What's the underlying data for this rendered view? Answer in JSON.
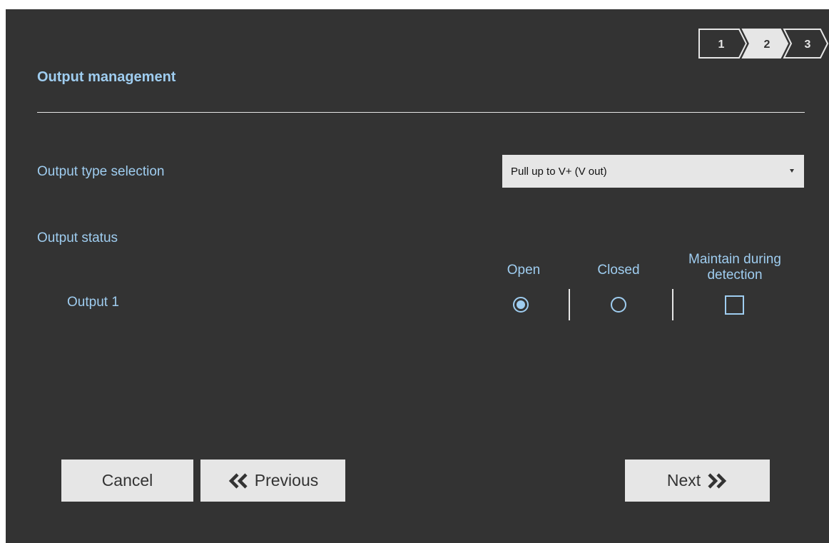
{
  "header": {
    "title": "Output management",
    "steps": [
      {
        "label": "1",
        "state": "done"
      },
      {
        "label": "2",
        "state": "current"
      },
      {
        "label": "3",
        "state": "upcoming"
      }
    ]
  },
  "output_type": {
    "label": "Output type selection",
    "selected": "Pull up to V+ (V out)"
  },
  "output_status": {
    "label": "Output status",
    "columns": {
      "open": "Open",
      "closed": "Closed",
      "maintain": "Maintain during detection"
    },
    "rows": [
      {
        "label": "Output 1",
        "open": true,
        "closed": false,
        "maintain": false
      }
    ]
  },
  "footer": {
    "cancel_label": "Cancel",
    "previous_label": "Previous",
    "next_label": "Next",
    "previous_icon": "double-chevron-left-icon",
    "next_icon": "double-chevron-right-icon"
  },
  "colors": {
    "background": "#333333",
    "accent": "#9fcdf0",
    "button_bg": "#e6e6e6",
    "text_dark": "#333333"
  }
}
